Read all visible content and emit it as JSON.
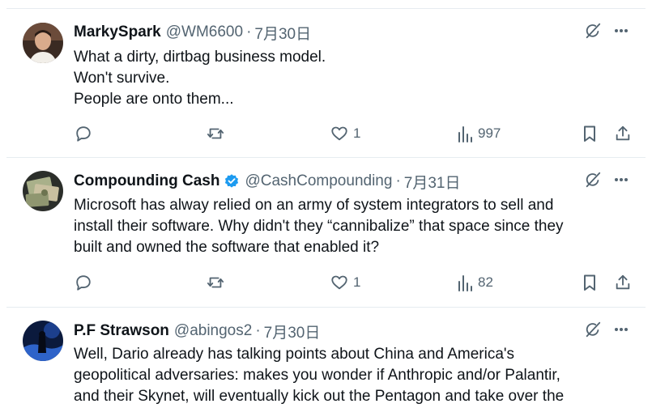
{
  "tweets": [
    {
      "name": "MarkySpark",
      "verified": false,
      "handle": "@WM6600",
      "separator": "·",
      "date": "7月30日",
      "lines": [
        "What a dirty, dirtbag business model.",
        "Won't survive.",
        "People are onto them..."
      ],
      "stats": {
        "replies": "",
        "reposts": "",
        "likes": "1",
        "views": "997"
      }
    },
    {
      "name": "Compounding Cash",
      "verified": true,
      "handle": "@CashCompounding",
      "separator": "·",
      "date": "7月31日",
      "lines": [
        "Microsoft has alway relied on an army of system integrators to sell and",
        "install their software. Why didn't they “cannibalize” that space since they",
        "built and owned the software that enabled it?"
      ],
      "stats": {
        "replies": "",
        "reposts": "",
        "likes": "1",
        "views": "82"
      }
    },
    {
      "name": "P.F Strawson",
      "verified": false,
      "handle": "@abingos2",
      "separator": "·",
      "date": "7月30日",
      "lines": [
        "Well, Dario already has talking points about China and America's",
        "geopolitical adversaries: makes you wonder if Anthropic and/or Palantir,",
        "and their  Skynet, will eventually kick out the Pentagon and take over the"
      ]
    }
  ],
  "icons": {
    "reply": "reply-icon",
    "repost": "repost-icon",
    "like": "heart-icon",
    "views": "views-icon",
    "bookmark": "bookmark-icon",
    "share": "share-icon",
    "grok": "grok-icon",
    "more": "more-icon"
  },
  "colors": {
    "text": "#0f1419",
    "secondary": "#536471",
    "verified": "#1d9bf0",
    "divider": "#e6ecf0"
  }
}
